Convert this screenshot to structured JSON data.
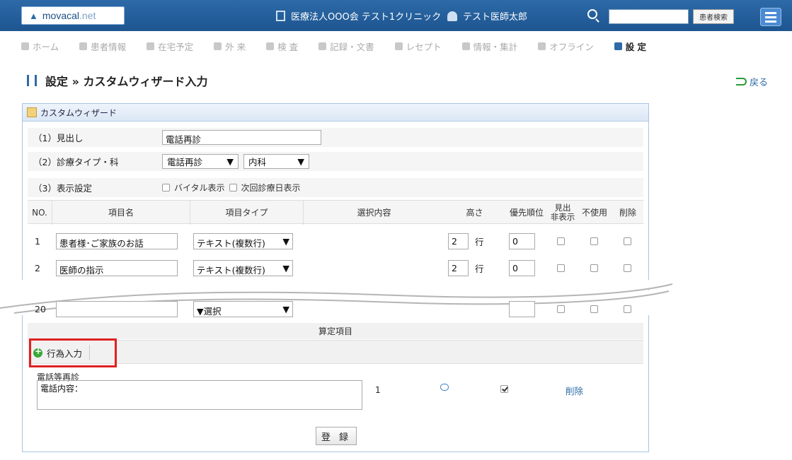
{
  "header": {
    "logo_text": "movacal",
    "logo_suffix": ".net",
    "organization": "医療法人OOO会 テスト1クリニック",
    "user_name": "テスト医師太郎",
    "search_value": "",
    "search_button": "患者検索"
  },
  "nav": {
    "items": [
      {
        "label": "ホーム"
      },
      {
        "label": "患者情報"
      },
      {
        "label": "在宅予定"
      },
      {
        "label": "外 来"
      },
      {
        "label": "検 査"
      },
      {
        "label": "記録・文書"
      },
      {
        "label": "レセプト"
      },
      {
        "label": "情報・集計"
      },
      {
        "label": "オフライン"
      },
      {
        "label": "設 定"
      }
    ]
  },
  "page": {
    "title": "設定 » カスタムウィザード入力",
    "back_label": "戻る"
  },
  "panel": {
    "title": "カスタムウィザード",
    "heading_label": "（1）見出し",
    "heading_value": "電話再診",
    "type_label": "（2）診療タイプ・科",
    "type_value": "電話再診",
    "dept_value": "内科",
    "display_label": "（3）表示設定",
    "vital_label": "バイタル表示",
    "next_label": "次回診療日表示"
  },
  "table": {
    "headers": [
      "NO.",
      "項目名",
      "項目タイプ",
      "選択内容",
      "高さ",
      "優先順位",
      "見出\n非表示",
      "不使用",
      "削除"
    ],
    "rows": [
      {
        "no": "1",
        "name": "患者様･ご家族のお話",
        "type": "テキスト(複数行)",
        "height": "2",
        "unit": "行",
        "priority": "0"
      },
      {
        "no": "2",
        "name": "医師の指示",
        "type": "テキスト(複数行)",
        "height": "2",
        "unit": "行",
        "priority": "0"
      },
      {
        "no": "20",
        "name": "",
        "type": "▼選択",
        "height": "",
        "unit": "",
        "priority": ""
      }
    ]
  },
  "santei": {
    "section_title": "算定項目",
    "action_button": "行為入力",
    "item_name": "電話等再診",
    "item_note": "電話内容：",
    "item_qty": "1",
    "item_delete": "削除"
  },
  "register_button": "登 録"
}
